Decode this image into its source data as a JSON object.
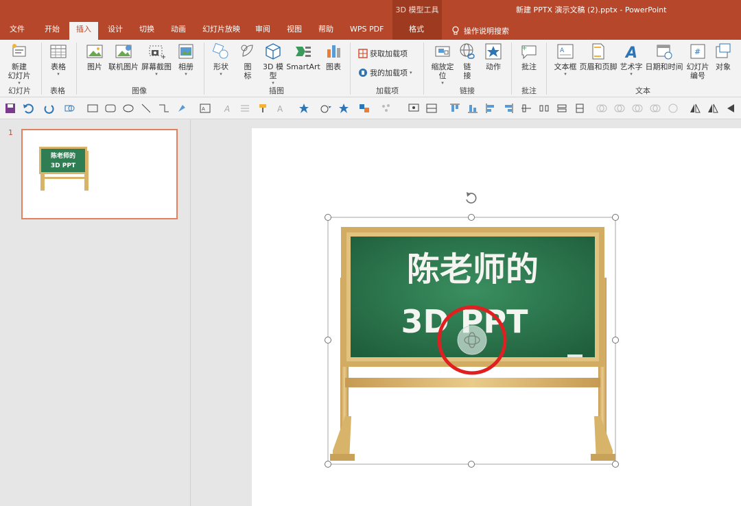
{
  "titlebar": {
    "context_group": "3D 模型工具",
    "document_title": "新建 PPTX 演示文稿 (2).pptx  -  PowerPoint"
  },
  "tabs": [
    {
      "label": "文件"
    },
    {
      "label": "开始"
    },
    {
      "label": "插入"
    },
    {
      "label": "设计"
    },
    {
      "label": "切换"
    },
    {
      "label": "动画"
    },
    {
      "label": "幻灯片放映"
    },
    {
      "label": "审阅"
    },
    {
      "label": "视图"
    },
    {
      "label": "帮助"
    },
    {
      "label": "WPS PDF"
    },
    {
      "label": "格式"
    }
  ],
  "active_tab": "插入",
  "tell_me": "操作说明搜索",
  "ribbon": {
    "buttons": [
      {
        "label": "新建\n幻灯片",
        "caret": true,
        "icon": "new-slide-icon"
      },
      {
        "label": "表格",
        "caret": true,
        "icon": "table-icon"
      },
      {
        "label": "图片",
        "caret": false,
        "icon": "picture-icon"
      },
      {
        "label": "联机图片",
        "caret": false,
        "icon": "online-picture-icon"
      },
      {
        "label": "屏幕截图",
        "caret": true,
        "icon": "screenshot-icon"
      },
      {
        "label": "相册",
        "caret": true,
        "icon": "album-icon"
      },
      {
        "label": "形状",
        "caret": true,
        "icon": "shapes-icon"
      },
      {
        "label": "图\n标",
        "caret": false,
        "icon": "icons-icon"
      },
      {
        "label": "3D 模\n型",
        "caret": true,
        "icon": "3d-model-icon"
      },
      {
        "label": "SmartArt",
        "caret": false,
        "icon": "smartart-icon"
      },
      {
        "label": "图表",
        "caret": false,
        "icon": "chart-icon"
      },
      {
        "label": "缩放定\n位",
        "caret": true,
        "icon": "zoom-icon"
      },
      {
        "label": "链\n接",
        "caret": false,
        "icon": "link-icon"
      },
      {
        "label": "动作",
        "caret": false,
        "icon": "action-icon"
      },
      {
        "label": "批注",
        "caret": false,
        "icon": "comment-icon"
      },
      {
        "label": "文本框",
        "caret": true,
        "icon": "textbox-icon"
      },
      {
        "label": "页眉和页脚",
        "caret": false,
        "icon": "header-footer-icon"
      },
      {
        "label": "艺术字",
        "caret": true,
        "icon": "wordart-icon"
      },
      {
        "label": "日期和时间",
        "caret": false,
        "icon": "date-time-icon"
      },
      {
        "label": "幻灯片\n编号",
        "caret": false,
        "icon": "slide-number-icon"
      },
      {
        "label": "对象",
        "caret": false,
        "icon": "object-icon"
      }
    ],
    "addins": {
      "get": "获取加载项",
      "mine": "我的加载项"
    },
    "groups": [
      "幻灯片",
      "表格",
      "图像",
      "插图",
      "加载项",
      "链接",
      "批注",
      "文本"
    ]
  },
  "slides": {
    "number": "1"
  },
  "slide_content": {
    "line1": "陈老师的",
    "line2": "3D PPT"
  },
  "colors": {
    "accent": "#b7472a",
    "board": "#2f7d52",
    "frame": "#d8b46a",
    "highlight_circle": "#e02020"
  }
}
